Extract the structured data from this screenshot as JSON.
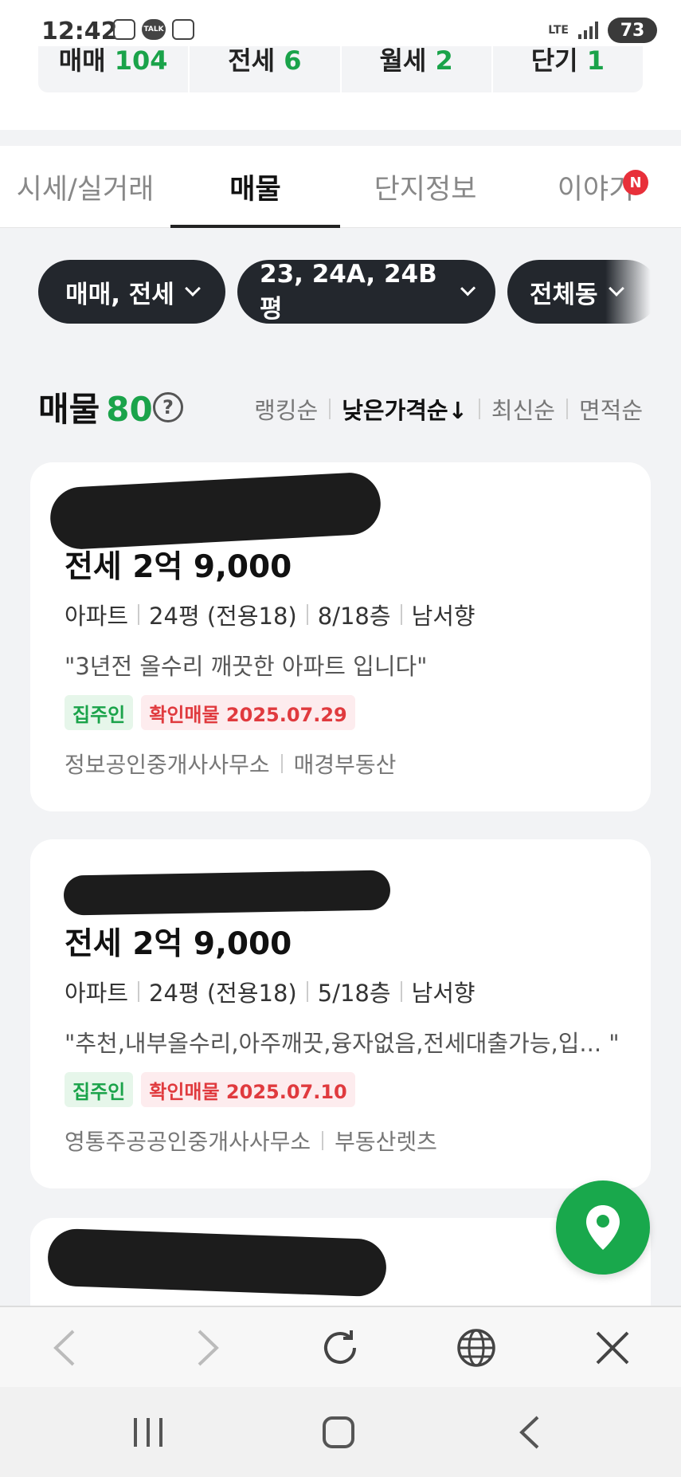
{
  "status_bar": {
    "time": "12:42",
    "talk_label": "TALK",
    "network": "LTE",
    "battery": "73"
  },
  "summary": {
    "items": [
      {
        "label": "매매",
        "count": "104"
      },
      {
        "label": "전세",
        "count": "6"
      },
      {
        "label": "월세",
        "count": "2"
      },
      {
        "label": "단기",
        "count": "1"
      }
    ]
  },
  "tabs": {
    "items": [
      "시세/실거래",
      "매물",
      "단지정보",
      "이야기"
    ],
    "active": "매물",
    "new_badge": "N"
  },
  "filters": {
    "chips": [
      "매매, 전세",
      "23, 24A, 24B평",
      "전체동"
    ]
  },
  "listing_header": {
    "title": "매물",
    "count": "80",
    "help": "?",
    "sorts": [
      "랭킹순",
      "낮은가격순↓",
      "최신순",
      "면적순"
    ],
    "active_sort": "낮은가격순↓"
  },
  "listings": [
    {
      "price": "전세 2억 9,000",
      "type": "아파트",
      "size": "24평 (전용18)",
      "floor": "8/18층",
      "direction": "남서향",
      "description": "\"3년전 올수리 깨끗한 아파트 입니다\"",
      "tag_owner": "집주인",
      "tag_verified": "확인매물 2025.07.29",
      "agency": "정보공인중개사사무소",
      "provider": "매경부동산"
    },
    {
      "price": "전세 2억 9,000",
      "type": "아파트",
      "size": "24평 (전용18)",
      "floor": "5/18층",
      "direction": "남서향",
      "description": "\"추천,내부올수리,아주깨끗,융자없음,전세대출가능,입... \"",
      "tag_owner": "집주인",
      "tag_verified": "확인매물 2025.07.10",
      "agency": "영통주공공인중개사사무소",
      "provider": "부동산렛츠"
    }
  ],
  "colors": {
    "accent_green": "#1aa34a",
    "tag_red": "#e03a3e",
    "chip_dark": "#23272d",
    "new_badge": "#e8303a"
  },
  "icons": {
    "fab": "map-pin-icon",
    "browser": [
      "back-arrow-icon",
      "forward-arrow-icon",
      "refresh-icon",
      "globe-icon",
      "close-icon"
    ],
    "system": [
      "recent-apps-icon",
      "home-icon",
      "back-icon"
    ]
  }
}
